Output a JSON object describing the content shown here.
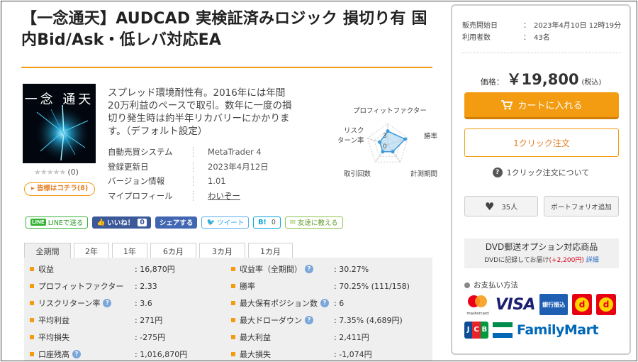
{
  "product": {
    "title": "【一念通天】AUDCAD 実検証済みロジック 損切り有 国内Bid/Ask・低レバ対応EA",
    "image_text": "一念 通天",
    "rating_stars": "★★★★★",
    "rating_value": 0,
    "review_count": "(0)",
    "reviews_button": "▸ 皆様はコチラ(8)",
    "description": "スプレッド環境耐性有。2016年には年間20万利益のペースで取引。数年に一度の損切り発生時は約半年リカバリーにかかります。（デフォルト設定）"
  },
  "specs": [
    {
      "key": "自動売買システム",
      "value": "MetaTrader 4"
    },
    {
      "key": "登録更新日",
      "value": "2023年4月12日"
    },
    {
      "key": "バージョン情報",
      "value": "1.01"
    },
    {
      "key": "マイプロフィール",
      "value": "わいぞー"
    }
  ],
  "radar": {
    "labels": [
      "プロフィットファクター",
      "勝率",
      "計測期間",
      "取引回数",
      "リスク\nターン率"
    ],
    "label_lines": {
      "risk1": "リスク",
      "risk2": "ターン率"
    },
    "scale_labels": [
      "3",
      "0"
    ],
    "values": [
      3.2,
      4.3,
      2.0,
      2.0,
      2.0
    ],
    "max": 5,
    "fill": "#a8d4f0",
    "stroke": "#3d9ad8"
  },
  "share": {
    "line": "LINEで送る",
    "line_icon": "LINE",
    "like": "いいね！",
    "like_count": "0",
    "fb_share": "シェアする",
    "tweet": "ツイート",
    "hatena": "B!",
    "hatena_count": "0",
    "mail": "友達に教える"
  },
  "tabs": [
    "全期間",
    "2年",
    "1年",
    "6カ月",
    "3カ月",
    "1カ月"
  ],
  "stats": {
    "left": [
      {
        "key": "収益",
        "value": "16,870円",
        "help": false
      },
      {
        "key": "プロフィットファクター",
        "value": "2.33",
        "help": false
      },
      {
        "key": "リスクリターン率",
        "value": "3.6",
        "help": true
      },
      {
        "key": "平均利益",
        "value": "271円",
        "help": false
      },
      {
        "key": "平均損失",
        "value": "-275円",
        "help": false
      },
      {
        "key": "口座残高",
        "value": "1,016,870円",
        "help": true
      }
    ],
    "right": [
      {
        "key": "収益率（全期間）",
        "value": "30.27%",
        "help": true
      },
      {
        "key": "勝率",
        "value": "70.25% (111/158)",
        "help": false
      },
      {
        "key": "最大保有ポジション数",
        "value": "6",
        "help": true
      },
      {
        "key": "最大ドローダウン",
        "value": "7.35% (4,689円)",
        "help": true
      },
      {
        "key": "最大利益",
        "value": "2,411円",
        "help": false
      },
      {
        "key": "最大損失",
        "value": "-1,074円",
        "help": false
      }
    ],
    "separator": ":"
  },
  "sidebar": {
    "meta": [
      {
        "key": "販売開始日",
        "value": "：　2023年4月10日 12時19分"
      },
      {
        "key": "利用者数",
        "value": "：　43名"
      }
    ],
    "price_label": "価格：",
    "price_value": "￥19,800",
    "price_tax": "(税込)",
    "cart_button": "カートに入れる",
    "oneclick_button": "1クリック注文",
    "about_oneclick": "1クリック注文について",
    "fav_count": "35人",
    "portfolio_button": "ポートフォリオ追加",
    "dvd_title": "DVD郵送オプション対応商品",
    "dvd_note": "DVDに記録してお届け",
    "dvd_price": "(+2,200円)",
    "dvd_link": "詳細",
    "payment_title": "お支払い方法",
    "payment": {
      "mastercard": "mastercard",
      "visa": "VISA",
      "bank": "銀行振込",
      "d_letter": "d",
      "jcb": [
        "J",
        "C",
        "B"
      ],
      "familymart": "FamilyMart"
    }
  },
  "colors": {
    "accent": "#f39c12",
    "accent_dark": "#e67e22",
    "help": "#7aa6d8"
  }
}
